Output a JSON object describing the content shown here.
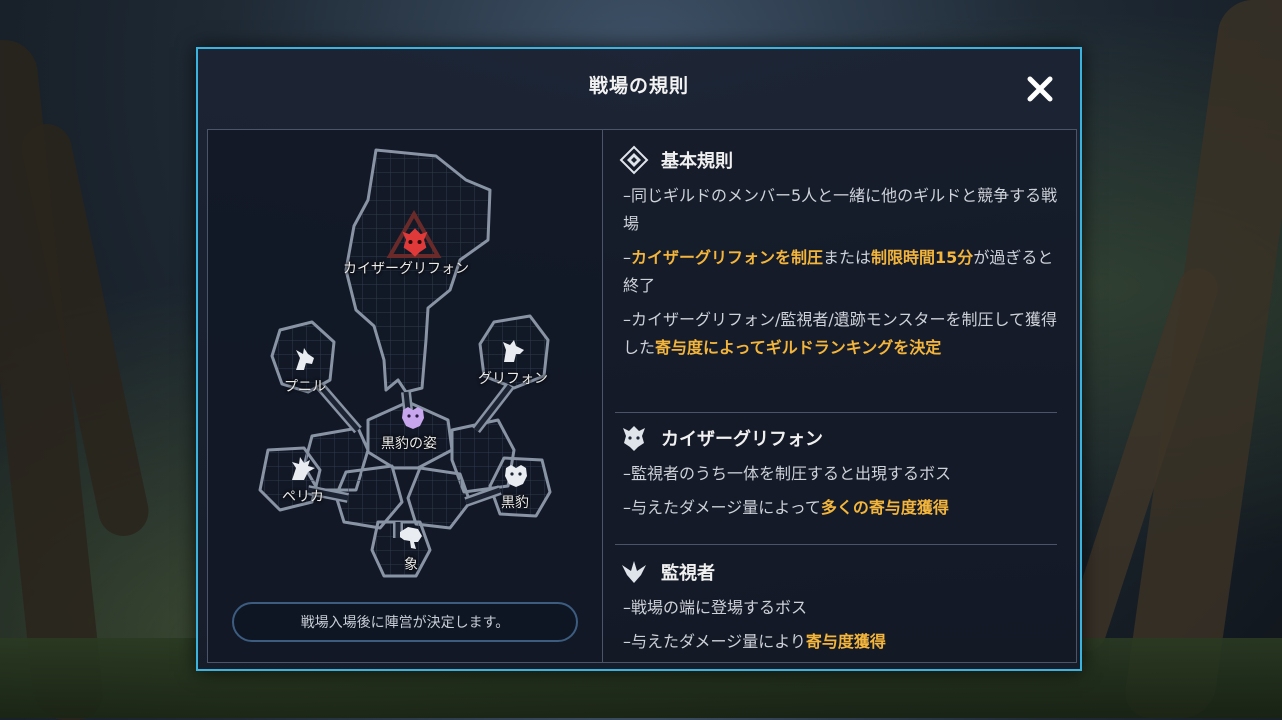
{
  "modal": {
    "title": "戦場の規則"
  },
  "map": {
    "nodes": [
      {
        "id": "kaiser",
        "label": "カイザーグリフォン",
        "icon": "dragon-head-icon",
        "color": "#e0393a"
      },
      {
        "id": "punil",
        "label": "プニル",
        "icon": "horse-head-icon",
        "color": "#e9edf2"
      },
      {
        "id": "griffon",
        "label": "グリフォン",
        "icon": "griffon-head-icon",
        "color": "#e9edf2"
      },
      {
        "id": "panther-form",
        "label": "黒豹の姿",
        "icon": "panther-head-icon",
        "color": "#c7a6ee"
      },
      {
        "id": "perica",
        "label": "ペリカ",
        "icon": "pelican-head-icon",
        "color": "#e9edf2"
      },
      {
        "id": "panther",
        "label": "黒豹",
        "icon": "panther-head-icon",
        "color": "#e9edf2"
      },
      {
        "id": "elephant",
        "label": "象",
        "icon": "elephant-head-icon",
        "color": "#e9edf2"
      }
    ],
    "notice": "戦場入場後に陣営が決定します。"
  },
  "rules": {
    "basic": {
      "title": "基本規則",
      "icon": "diamond-emblem-icon",
      "lines": [
        [
          {
            "t": "–同じギルドのメンバー5人と一緒に他のギルドと競争する戦場"
          }
        ],
        [
          {
            "t": "–"
          },
          {
            "t": "カイザーグリフォンを制圧",
            "hl": true
          },
          {
            "t": "または"
          },
          {
            "t": "制限時間15分",
            "hl": true
          },
          {
            "t": "が過ぎると終了"
          }
        ],
        [
          {
            "t": "–カイザーグリフォン/監視者/遺跡モンスターを制圧して獲得した"
          },
          {
            "t": "寄与度によってギルドランキングを決定",
            "hl": true
          }
        ]
      ]
    },
    "kaiser": {
      "title": "カイザーグリフォン",
      "icon": "griffon-emblem-icon",
      "lines": [
        [
          {
            "t": "–監視者のうち一体を制圧すると出現するボス"
          }
        ],
        [
          {
            "t": "–与えたダメージ量によって"
          },
          {
            "t": "多くの寄与度獲得",
            "hl": true
          }
        ]
      ]
    },
    "watcher": {
      "title": "監視者",
      "icon": "watcher-emblem-icon",
      "lines": [
        [
          {
            "t": "–戦場の端に登場するボス"
          }
        ],
        [
          {
            "t": "–与えたダメージ量により"
          },
          {
            "t": "寄与度獲得",
            "hl": true
          }
        ]
      ]
    }
  },
  "colors": {
    "accent_border": "#3ab3df",
    "highlight": "#f3b53b",
    "kaiser_icon": "#e0393a"
  }
}
